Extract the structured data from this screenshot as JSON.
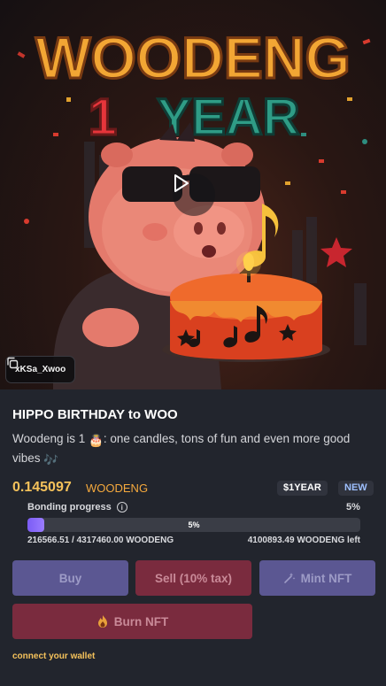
{
  "hero": {
    "headline_line1": "WOODENG",
    "headline_number": "1",
    "headline_line2": "YEAR",
    "address": "xKSa_Xwoo"
  },
  "token": {
    "title": "HIPPO BIRTHDAY to WOO",
    "description": "Woodeng is 1 ",
    "description_emoji": "🎂",
    "description_rest": ": one candles, tons of fun and even more good vibes ",
    "description_end_emoji": "🎶",
    "price": "0.145097",
    "price_unit": "WOODENG",
    "ticker": "$1YEAR",
    "new_badge": "NEW"
  },
  "bonding": {
    "label": "Bonding progress",
    "percent_label": "5%",
    "bar_label": "5%",
    "progress_fraction": 0.05,
    "raised": "216566.51 / 4317460.00 WOODENG",
    "remaining": "4100893.49 WOODENG left"
  },
  "actions": {
    "buy": "Buy",
    "sell": "Sell (10% tax)",
    "mint": "Mint NFT",
    "burn": "Burn NFT",
    "connect": "connect your wallet"
  },
  "colors": {
    "accent_price": "#f5c25b",
    "buy_bg": "#5b5792",
    "sell_bg": "#7a2b3e",
    "progress_fill": "#7b5cf5"
  },
  "icons": {
    "play": "play-icon",
    "copy": "copy-icon",
    "info": "info-icon",
    "mint": "wand-icon",
    "burn": "fire-icon"
  }
}
